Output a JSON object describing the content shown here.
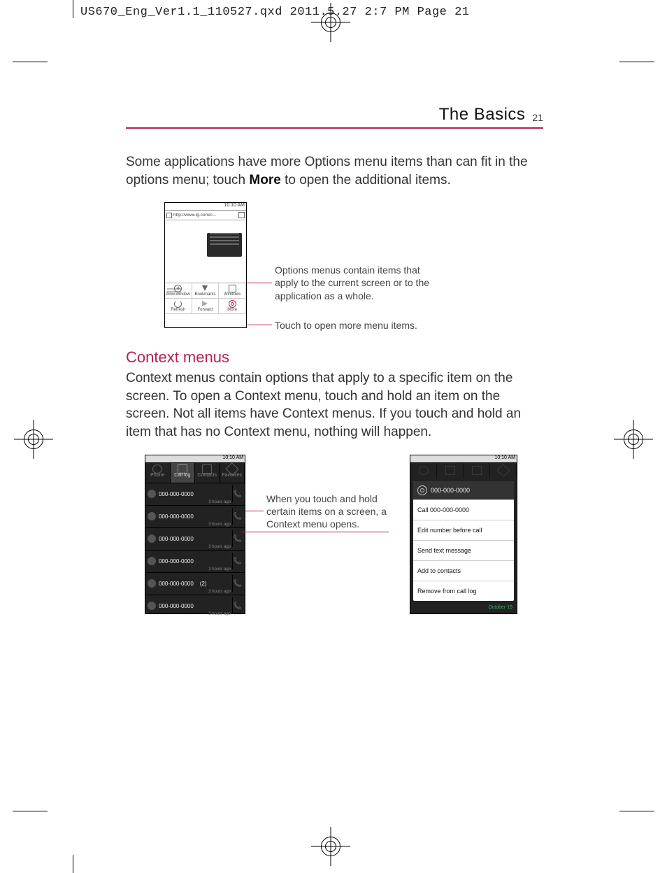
{
  "print_header": "US670_Eng_Ver1.1_110527.qxd  2011.5.27  2:7 PM  Page 21",
  "section_title": "The Basics",
  "page_number": "21",
  "intro_part1": "Some applications have more Options menu items than can fit in the options menu; touch ",
  "intro_more": "More",
  "intro_part2": " to open the additional items.",
  "browser": {
    "status_time": "10:10 AM",
    "url": "http://www.lg.com/c...",
    "options": [
      {
        "label": "New window"
      },
      {
        "label": "Bookmarks"
      },
      {
        "label": "Windows"
      },
      {
        "label": "Refresh"
      },
      {
        "label": "Forward"
      },
      {
        "label": "More"
      }
    ]
  },
  "annotation_options": "Options menus contain items that apply to the current screen or to the application as a whole.",
  "annotation_more_touch": "Touch to open more menu items.",
  "heading_context": "Context menus",
  "context_body": "Context menus contain options that apply to a specific item on the screen. To open a Context menu, touch and hold an item on the screen. Not all items have Context menus. If you touch and hold an item that has no Context menu, nothing will happen.",
  "calllog": {
    "status_time": "10:10 AM",
    "tabs": [
      "Phone",
      "Call log",
      "Contacts",
      "Favorites"
    ],
    "entries": [
      {
        "num": "000-000-0000",
        "sub": "3 hours ago",
        "extra": ""
      },
      {
        "num": "000-000-0000",
        "sub": "3 hours ago",
        "extra": ""
      },
      {
        "num": "000-000-0000",
        "sub": "3 hours ago",
        "extra": ""
      },
      {
        "num": "000-000-0000",
        "sub": "3 hours ago",
        "extra": ""
      },
      {
        "num": "000-000-0000",
        "sub": "3 hours ago",
        "extra": "(2)"
      },
      {
        "num": "000-000-0000",
        "sub": "3 hours ago",
        "extra": ""
      }
    ]
  },
  "annotation_context_open": "When you touch and hold certain items on a screen, a Context menu opens.",
  "context_menu": {
    "status_time": "10:10 AM",
    "title_number": "000-000-0000",
    "items": [
      "Call 000-000-0000",
      "Edit number before call",
      "Send text message",
      "Add to contacts",
      "Remove from call log"
    ],
    "footer": "October 19"
  }
}
